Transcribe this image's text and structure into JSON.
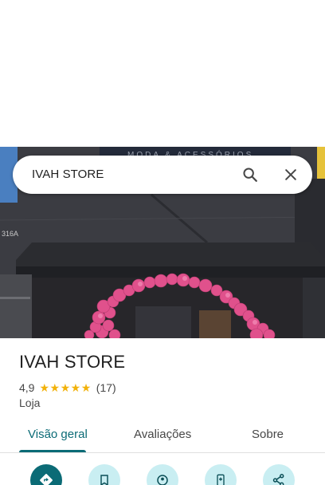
{
  "search": {
    "query": "IVAH STORE",
    "search_icon": "search-icon",
    "close_icon": "close-icon"
  },
  "photo": {
    "sign_text": "MODA & ACESSÓRIOS",
    "address_text": "316A",
    "balloon_color": "#e24a8a"
  },
  "place": {
    "name": "IVAH STORE",
    "rating": "4,9",
    "stars": 5,
    "review_count": "(17)",
    "category": "Loja"
  },
  "tabs": [
    {
      "label": "Visão geral",
      "active": true
    },
    {
      "label": "Avaliações",
      "active": false
    },
    {
      "label": "Sobre",
      "active": false
    }
  ],
  "actions": [
    {
      "icon": "directions-icon",
      "style": "primary"
    },
    {
      "icon": "bookmark-icon",
      "style": "secondary"
    },
    {
      "icon": "nearby-icon",
      "style": "secondary"
    },
    {
      "icon": "send-to-phone-icon",
      "style": "secondary"
    },
    {
      "icon": "share-icon",
      "style": "secondary"
    }
  ],
  "colors": {
    "accent": "#0b6b76",
    "accent_light": "#c9eef2",
    "star": "#f2b20b",
    "text_primary": "#1f1f1f",
    "text_secondary": "#474747"
  }
}
